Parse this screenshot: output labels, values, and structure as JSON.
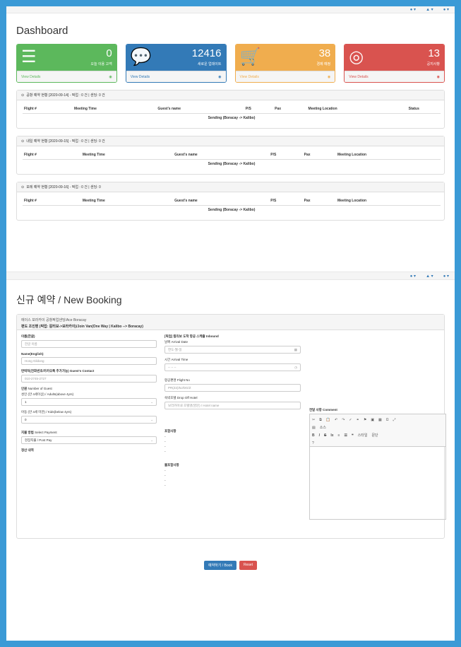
{
  "dashboard": {
    "title": "Dashboard",
    "panels": [
      {
        "value": "0",
        "label": "오늘 이용 고객",
        "footer": "View Details",
        "color": "#5cb85c",
        "icon": "server-icon"
      },
      {
        "value": "12416",
        "label": "새로운 업데이트",
        "footer": "View Details",
        "color": "#337ab7",
        "icon": "comments-icon"
      },
      {
        "value": "38",
        "label": "경제 예정",
        "footer": "View Details",
        "color": "#f0ad4e",
        "icon": "cart-icon"
      },
      {
        "value": "13",
        "label": "공지사항",
        "footer": "View Details",
        "color": "#d9534f",
        "icon": "lifebuoy-icon"
      }
    ],
    "schedules": [
      {
        "header": "공항 예약 현황 [2020-09-14] - 픽업 : 0 건 | 샌딩: 0 건",
        "columns": [
          "Flight #",
          "Meeting Time",
          "Guest's name",
          "P/S",
          "Pax",
          "Meeting Location",
          "Status"
        ],
        "row": "Sending (Boracay -> Kalibo)"
      },
      {
        "header": "내일 예약 현황 [2020-09-15] - 픽업 : 0 건 | 샌딩: 0 건",
        "columns": [
          "Flight #",
          "Meeting Time",
          "Guest's name",
          "P/S",
          "Pax",
          "Meeting Location"
        ],
        "row": "Sending (Boracay -> Kalibo)"
      },
      {
        "header": "모레 예약 현황 [2020-09-16] - 픽업 : 0 건 | 샌딩: 0",
        "columns": [
          "Flight #",
          "Meeting Time",
          "Guest's name",
          "P/S",
          "Pax",
          "Meeting Location"
        ],
        "row": "Sending (Boracay -> Kalibo)"
      }
    ]
  },
  "booking": {
    "title": "신규 예약 / New Booking",
    "header_line1": "에이스 보라카이 공항픽업샌딩/Ace Boracay",
    "header_line2": "편도 조인밴 (픽업: 칼리보->보라카이)/Join Van(One Way | Kalibo --> Boracay)",
    "name_kr_label": "이름(한글)",
    "name_kr_placeholder": "한글 이름",
    "name_en_label": "Name(English)",
    "name_en_placeholder": "Hong Gildong",
    "contact_label": "연락처(전화번호/카카오톡 추가가능)",
    "contact_label_en": "Guest's Contact",
    "contact_placeholder": "010-2745-2727",
    "guests_label": "인원",
    "guests_label_en": "Number of Guest",
    "adult_label": "성인 (만 4세이상) / Adults(above 4yrs)",
    "adult_value": "1",
    "kids_label": "아동 (만 4세 미만) / Kids(below 4yrs)",
    "kids_value": "0",
    "payment_label": "지불 방법",
    "payment_label_en": "Select Payment",
    "payment_value": "현장지불 / Post Pay",
    "settle_label": "정산 내역",
    "inbound_label": "[픽업] 칼리보 도착 항공 스케쥴",
    "inbound_label_en": "Inbound",
    "arr_date_label": "날짜",
    "arr_date_label_en": "Arrival Date",
    "arr_date_placeholder": "연도-월-일",
    "arr_time_label": "시간",
    "arr_time_label_en": "Arrival Time",
    "arr_time_placeholder": "-- -- --",
    "flight_label": "항공편명",
    "flight_label_en": "Flight No",
    "flight_placeholder": "PR(Z2)/5J/DG/Z",
    "hotel_label": "숙박호텔",
    "hotel_label_en": "Drop Off Hotel",
    "hotel_placeholder": "보라카이내 호텔명(영문) / Hotel name",
    "includes_label": "포함사항",
    "excludes_label": "불포함사항",
    "comment_label": "전달 사항",
    "comment_label_en": "Comment",
    "editor_source": "소스",
    "editor_style": "스타일",
    "editor_format": "문단",
    "book_button": "예약하기 / Book",
    "reset_button": "Reset"
  }
}
